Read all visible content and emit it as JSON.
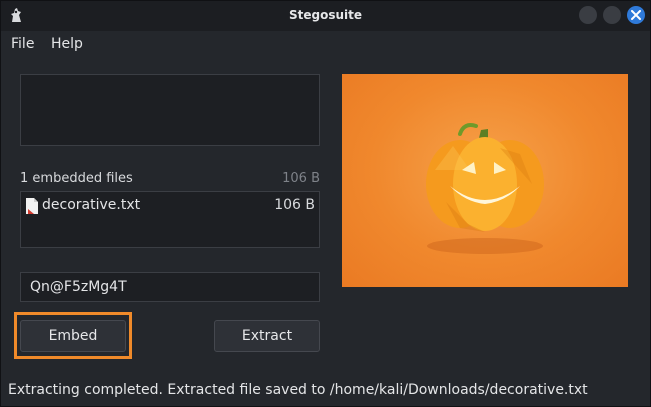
{
  "window": {
    "title": "Stegosuite"
  },
  "menu": {
    "file": "File",
    "help": "Help"
  },
  "message": {
    "text": ""
  },
  "files": {
    "count_label": "1 embedded files",
    "total_size": "106 B",
    "items": [
      {
        "name": "decorative.txt",
        "size": "106 B",
        "icon": "text-file-icon"
      }
    ]
  },
  "password": {
    "value": "Qn@F5zMg4T"
  },
  "buttons": {
    "embed": "Embed",
    "extract": "Extract"
  },
  "image": {
    "subject": "jack-o-lantern pumpkin",
    "background_color": "#f0882d"
  },
  "status": {
    "text": "Extracting completed. Extracted file saved to /home/kali/Downloads/decorative.txt"
  },
  "colors": {
    "accent_highlight": "#f08a2a",
    "close_button": "#2f7ad9"
  }
}
